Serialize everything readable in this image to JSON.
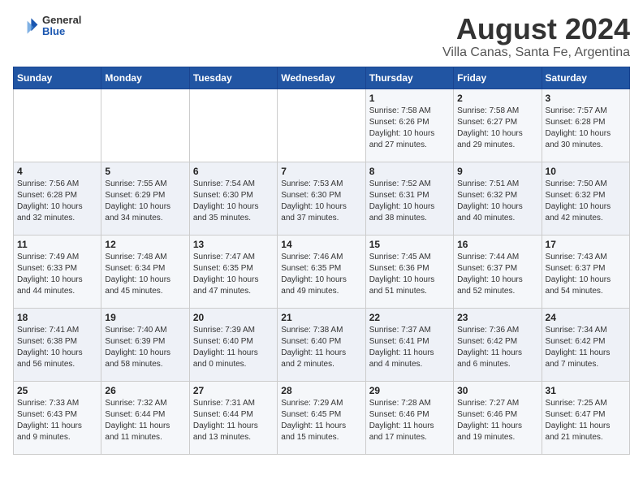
{
  "header": {
    "logo_general": "General",
    "logo_blue": "Blue",
    "title": "August 2024",
    "subtitle": "Villa Canas, Santa Fe, Argentina"
  },
  "weekdays": [
    "Sunday",
    "Monday",
    "Tuesday",
    "Wednesday",
    "Thursday",
    "Friday",
    "Saturday"
  ],
  "weeks": [
    [
      {
        "day": "",
        "info": ""
      },
      {
        "day": "",
        "info": ""
      },
      {
        "day": "",
        "info": ""
      },
      {
        "day": "",
        "info": ""
      },
      {
        "day": "1",
        "info": "Sunrise: 7:58 AM\nSunset: 6:26 PM\nDaylight: 10 hours\nand 27 minutes."
      },
      {
        "day": "2",
        "info": "Sunrise: 7:58 AM\nSunset: 6:27 PM\nDaylight: 10 hours\nand 29 minutes."
      },
      {
        "day": "3",
        "info": "Sunrise: 7:57 AM\nSunset: 6:28 PM\nDaylight: 10 hours\nand 30 minutes."
      }
    ],
    [
      {
        "day": "4",
        "info": "Sunrise: 7:56 AM\nSunset: 6:28 PM\nDaylight: 10 hours\nand 32 minutes."
      },
      {
        "day": "5",
        "info": "Sunrise: 7:55 AM\nSunset: 6:29 PM\nDaylight: 10 hours\nand 34 minutes."
      },
      {
        "day": "6",
        "info": "Sunrise: 7:54 AM\nSunset: 6:30 PM\nDaylight: 10 hours\nand 35 minutes."
      },
      {
        "day": "7",
        "info": "Sunrise: 7:53 AM\nSunset: 6:30 PM\nDaylight: 10 hours\nand 37 minutes."
      },
      {
        "day": "8",
        "info": "Sunrise: 7:52 AM\nSunset: 6:31 PM\nDaylight: 10 hours\nand 38 minutes."
      },
      {
        "day": "9",
        "info": "Sunrise: 7:51 AM\nSunset: 6:32 PM\nDaylight: 10 hours\nand 40 minutes."
      },
      {
        "day": "10",
        "info": "Sunrise: 7:50 AM\nSunset: 6:32 PM\nDaylight: 10 hours\nand 42 minutes."
      }
    ],
    [
      {
        "day": "11",
        "info": "Sunrise: 7:49 AM\nSunset: 6:33 PM\nDaylight: 10 hours\nand 44 minutes."
      },
      {
        "day": "12",
        "info": "Sunrise: 7:48 AM\nSunset: 6:34 PM\nDaylight: 10 hours\nand 45 minutes."
      },
      {
        "day": "13",
        "info": "Sunrise: 7:47 AM\nSunset: 6:35 PM\nDaylight: 10 hours\nand 47 minutes."
      },
      {
        "day": "14",
        "info": "Sunrise: 7:46 AM\nSunset: 6:35 PM\nDaylight: 10 hours\nand 49 minutes."
      },
      {
        "day": "15",
        "info": "Sunrise: 7:45 AM\nSunset: 6:36 PM\nDaylight: 10 hours\nand 51 minutes."
      },
      {
        "day": "16",
        "info": "Sunrise: 7:44 AM\nSunset: 6:37 PM\nDaylight: 10 hours\nand 52 minutes."
      },
      {
        "day": "17",
        "info": "Sunrise: 7:43 AM\nSunset: 6:37 PM\nDaylight: 10 hours\nand 54 minutes."
      }
    ],
    [
      {
        "day": "18",
        "info": "Sunrise: 7:41 AM\nSunset: 6:38 PM\nDaylight: 10 hours\nand 56 minutes."
      },
      {
        "day": "19",
        "info": "Sunrise: 7:40 AM\nSunset: 6:39 PM\nDaylight: 10 hours\nand 58 minutes."
      },
      {
        "day": "20",
        "info": "Sunrise: 7:39 AM\nSunset: 6:40 PM\nDaylight: 11 hours\nand 0 minutes."
      },
      {
        "day": "21",
        "info": "Sunrise: 7:38 AM\nSunset: 6:40 PM\nDaylight: 11 hours\nand 2 minutes."
      },
      {
        "day": "22",
        "info": "Sunrise: 7:37 AM\nSunset: 6:41 PM\nDaylight: 11 hours\nand 4 minutes."
      },
      {
        "day": "23",
        "info": "Sunrise: 7:36 AM\nSunset: 6:42 PM\nDaylight: 11 hours\nand 6 minutes."
      },
      {
        "day": "24",
        "info": "Sunrise: 7:34 AM\nSunset: 6:42 PM\nDaylight: 11 hours\nand 7 minutes."
      }
    ],
    [
      {
        "day": "25",
        "info": "Sunrise: 7:33 AM\nSunset: 6:43 PM\nDaylight: 11 hours\nand 9 minutes."
      },
      {
        "day": "26",
        "info": "Sunrise: 7:32 AM\nSunset: 6:44 PM\nDaylight: 11 hours\nand 11 minutes."
      },
      {
        "day": "27",
        "info": "Sunrise: 7:31 AM\nSunset: 6:44 PM\nDaylight: 11 hours\nand 13 minutes."
      },
      {
        "day": "28",
        "info": "Sunrise: 7:29 AM\nSunset: 6:45 PM\nDaylight: 11 hours\nand 15 minutes."
      },
      {
        "day": "29",
        "info": "Sunrise: 7:28 AM\nSunset: 6:46 PM\nDaylight: 11 hours\nand 17 minutes."
      },
      {
        "day": "30",
        "info": "Sunrise: 7:27 AM\nSunset: 6:46 PM\nDaylight: 11 hours\nand 19 minutes."
      },
      {
        "day": "31",
        "info": "Sunrise: 7:25 AM\nSunset: 6:47 PM\nDaylight: 11 hours\nand 21 minutes."
      }
    ]
  ]
}
